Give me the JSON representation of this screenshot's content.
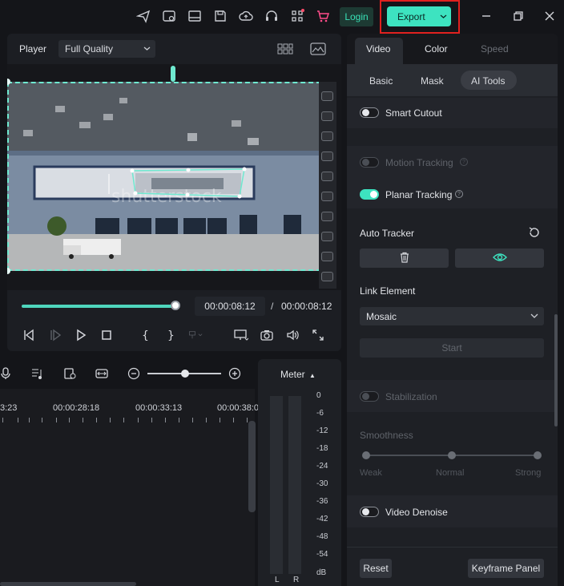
{
  "topbar": {
    "login_label": "Login",
    "export_label": "Export",
    "icons": [
      "send-icon",
      "render-icon",
      "layout-icon",
      "save-icon",
      "cloud-upload-icon",
      "headset-icon",
      "apps-grid-icon",
      "cart-icon"
    ]
  },
  "player": {
    "label": "Player",
    "quality": "Full Quality",
    "watermark": "shutterstock",
    "current_time": "00:00:08:12",
    "separator": "/",
    "total_time": "00:00:08:12",
    "progress": 1.0
  },
  "timeline": {
    "ruler_labels": [
      "3:23",
      "00:00:28:18",
      "00:00:33:13",
      "00:00:38:0"
    ]
  },
  "meter": {
    "title": "Meter",
    "scale": [
      "0",
      "-6",
      "-12",
      "-18",
      "-24",
      "-30",
      "-36",
      "-42",
      "-48",
      "-54",
      "dB"
    ],
    "left": "L",
    "right": "R"
  },
  "right_panel": {
    "tabs": [
      "Video",
      "Color",
      "Speed"
    ],
    "subtabs": [
      "Basic",
      "Mask",
      "AI Tools"
    ],
    "smart_cutout": "Smart Cutout",
    "motion_tracking": "Motion Tracking",
    "planar_tracking": "Planar Tracking",
    "auto_tracker": "Auto Tracker",
    "link_element": "Link Element",
    "link_value": "Mosaic",
    "start": "Start",
    "stabilization": "Stabilization",
    "smoothness": "Smoothness",
    "smooth_weak": "Weak",
    "smooth_normal": "Normal",
    "smooth_strong": "Strong",
    "video_denoise": "Video Denoise",
    "reset": "Reset",
    "keyframe_panel": "Keyframe Panel"
  },
  "colors": {
    "accent": "#3de3c0",
    "highlight": "#e0211f"
  }
}
